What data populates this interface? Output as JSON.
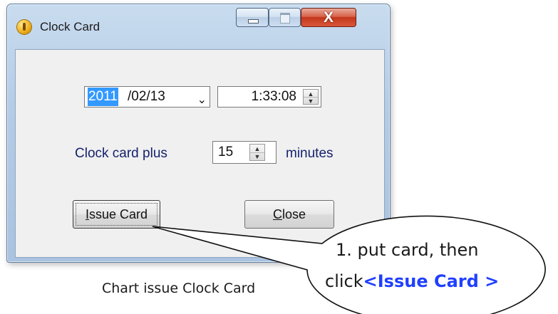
{
  "window": {
    "title": "Clock Card",
    "close_glyph": "X"
  },
  "form": {
    "date_year": "2011",
    "date_rest": "/02/13",
    "date_dropdown_glyph": "⌄",
    "time_value": "1:33:08",
    "plus_label": "Clock card plus",
    "minutes_value": "15",
    "minutes_unit_label": "minutes"
  },
  "buttons": {
    "issue_mnemonic": "I",
    "issue_rest": "ssue Card",
    "close_mnemonic": "C",
    "close_rest": "lose"
  },
  "callout": {
    "line1": "1. put card, then",
    "line2_prefix": "click",
    "line2_accent": "<Issue Card >"
  },
  "caption": "Chart issue Clock Card",
  "colors": {
    "label_text": "#16226e",
    "selection": "#3399ff",
    "callout_accent": "#1f3fff"
  }
}
